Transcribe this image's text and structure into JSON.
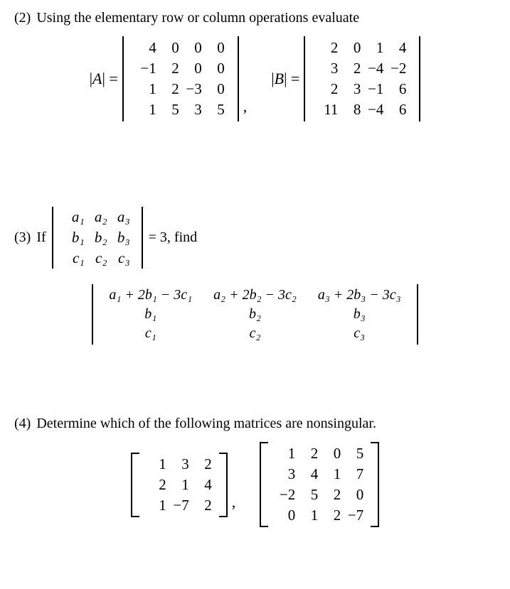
{
  "p2": {
    "num": "(2)",
    "text": "Using the elementary row or column operations evaluate",
    "A_label_pre": "|",
    "A_label_var": "A",
    "A_label_post": "| =",
    "B_label_pre": "|",
    "B_label_var": "B",
    "B_label_post": "| =",
    "A": [
      [
        "4",
        "0",
        "0",
        "0"
      ],
      [
        "−1",
        "2",
        "0",
        "0"
      ],
      [
        "1",
        "2",
        "−3",
        "0"
      ],
      [
        "1",
        "5",
        "3",
        "5"
      ]
    ],
    "B": [
      [
        "2",
        "0",
        "1",
        "4"
      ],
      [
        "3",
        "2",
        "−4",
        "−2"
      ],
      [
        "2",
        "3",
        "−1",
        "6"
      ],
      [
        "11",
        "8",
        "−4",
        "6"
      ]
    ],
    "sep": ","
  },
  "p3": {
    "num": "(3)",
    "text_pre": "If",
    "small": [
      [
        "a₁",
        "a₂",
        "a₃"
      ],
      [
        "b₁",
        "b₂",
        "b₃"
      ],
      [
        "c₁",
        "c₂",
        "c₃"
      ]
    ],
    "text_post": "= 3, find",
    "big": [
      [
        "a₁ + 2b₁ − 3c₁",
        "a₂ + 2b₂ − 3c₂",
        "a₃ + 2b₃ − 3c₃"
      ],
      [
        "b₁",
        "b₂",
        "b₃"
      ],
      [
        "c₁",
        "c₂",
        "c₃"
      ]
    ]
  },
  "p4": {
    "num": "(4)",
    "text": "Determine which of the following matrices are nonsingular.",
    "M1": [
      [
        "1",
        "3",
        "2"
      ],
      [
        "2",
        "1",
        "4"
      ],
      [
        "1",
        "−7",
        "2"
      ]
    ],
    "M2": [
      [
        "1",
        "2",
        "0",
        "5"
      ],
      [
        "3",
        "4",
        "1",
        "7"
      ],
      [
        "−2",
        "5",
        "2",
        "0"
      ],
      [
        "0",
        "1",
        "2",
        "−7"
      ]
    ],
    "sep": ","
  }
}
